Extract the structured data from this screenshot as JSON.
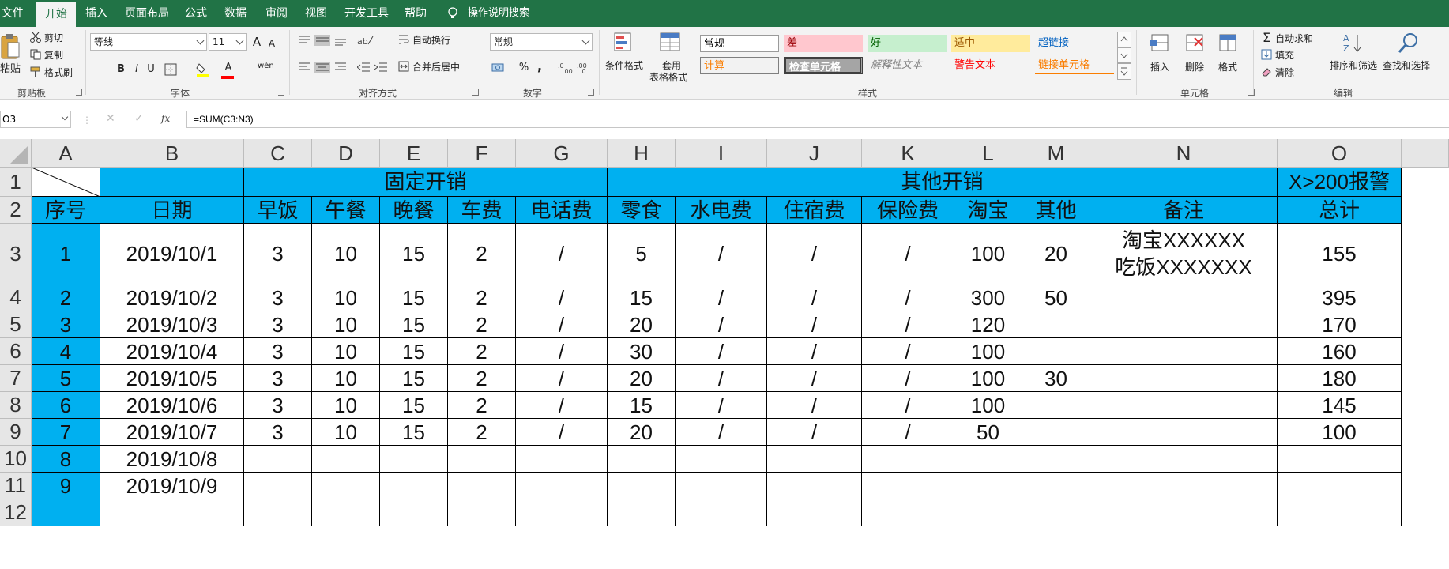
{
  "menu": {
    "tabs": [
      "文件",
      "开始",
      "插入",
      "页面布局",
      "公式",
      "数据",
      "审阅",
      "视图",
      "开发工具",
      "帮助"
    ],
    "active": "开始",
    "tell_me": "操作说明搜索"
  },
  "ribbon": {
    "clipboard": {
      "group": "剪贴板",
      "paste": "粘贴",
      "cut": "剪切",
      "copy": "复制",
      "format_painter": "格式刷"
    },
    "font": {
      "group": "字体",
      "name": "等线",
      "size": "11",
      "bold": "B",
      "italic": "I",
      "underline": "U",
      "grow": "A",
      "shrink": "A",
      "font_color": "A",
      "phonetic": "wén"
    },
    "alignment": {
      "group": "对齐方式",
      "wrap": "自动换行",
      "merge": "合并后居中"
    },
    "number": {
      "group": "数字",
      "format": "常规",
      "percent": "%",
      "comma": ","
    },
    "styles": {
      "group": "样式",
      "conditional": "条件格式",
      "table": [
        "套用",
        "表格格式"
      ],
      "cells": [
        {
          "label": "常规",
          "fg": "#000000",
          "bg": "#ffffff"
        },
        {
          "label": "差",
          "fg": "#9c0006",
          "bg": "#ffc7ce"
        },
        {
          "label": "好",
          "fg": "#006100",
          "bg": "#c6efce"
        },
        {
          "label": "适中",
          "fg": "#9c5700",
          "bg": "#ffeb9c"
        },
        {
          "label": "超链接",
          "fg": "#0563c1",
          "bg": "#f3f3f3"
        },
        {
          "label": "计算",
          "fg": "#fa7d00",
          "bg": "#f2f2f2"
        },
        {
          "label": "检查单元格",
          "fg": "#ffffff",
          "bg": "#a5a5a5"
        },
        {
          "label": "解释性文本",
          "fg": "#7f7f7f",
          "bg": "#f3f3f3"
        },
        {
          "label": "警告文本",
          "fg": "#ff0000",
          "bg": "#f3f3f3"
        },
        {
          "label": "链接单元格",
          "fg": "#fa7d00",
          "bg": "#f3f3f3"
        }
      ]
    },
    "cells_group": {
      "group": "单元格",
      "insert": "插入",
      "delete": "删除",
      "format": "格式"
    },
    "editing": {
      "group": "编辑",
      "autosum": "自动求和",
      "fill": "填充",
      "clear": "清除",
      "sort": "排序和筛选",
      "find": "查找和选择"
    }
  },
  "formula_bar": {
    "name_box": "O3",
    "fx": "fx",
    "formula": "=SUM(C3:N3)"
  },
  "columns": [
    "A",
    "B",
    "C",
    "D",
    "E",
    "F",
    "G",
    "H",
    "I",
    "J",
    "K",
    "L",
    "M",
    "N",
    "O"
  ],
  "rows": [
    "1",
    "2",
    "3",
    "4",
    "5",
    "6",
    "7",
    "8",
    "9",
    "10",
    "11",
    "12"
  ],
  "sheet": {
    "group_fixed": "固定开销",
    "group_other": "其他开销",
    "alert": "X>200报警",
    "headers": [
      "序号",
      "日期",
      "早饭",
      "午餐",
      "晚餐",
      "车费",
      "电话费",
      "零食",
      "水电费",
      "住宿费",
      "保险费",
      "淘宝",
      "其他",
      "备注",
      "总计"
    ],
    "data": [
      [
        "1",
        "2019/10/1",
        "3",
        "10",
        "15",
        "2",
        "/",
        "5",
        "/",
        "/",
        "/",
        "100",
        "20",
        "",
        "155"
      ],
      [
        "2",
        "2019/10/2",
        "3",
        "10",
        "15",
        "2",
        "/",
        "15",
        "/",
        "/",
        "/",
        "300",
        "50",
        "",
        "395"
      ],
      [
        "3",
        "2019/10/3",
        "3",
        "10",
        "15",
        "2",
        "/",
        "20",
        "/",
        "/",
        "/",
        "120",
        "",
        "",
        "170"
      ],
      [
        "4",
        "2019/10/4",
        "3",
        "10",
        "15",
        "2",
        "/",
        "30",
        "/",
        "/",
        "/",
        "100",
        "",
        "",
        "160"
      ],
      [
        "5",
        "2019/10/5",
        "3",
        "10",
        "15",
        "2",
        "/",
        "20",
        "/",
        "/",
        "/",
        "100",
        "30",
        "",
        "180"
      ],
      [
        "6",
        "2019/10/6",
        "3",
        "10",
        "15",
        "2",
        "/",
        "15",
        "/",
        "/",
        "/",
        "100",
        "",
        "",
        "145"
      ],
      [
        "7",
        "2019/10/7",
        "3",
        "10",
        "15",
        "2",
        "/",
        "20",
        "/",
        "/",
        "/",
        "50",
        "",
        "",
        "100"
      ],
      [
        "8",
        "2019/10/8",
        "",
        "",
        "",
        "",
        "",
        "",
        "",
        "",
        "",
        "",
        "",
        "",
        ""
      ],
      [
        "9",
        "2019/10/9",
        "",
        "",
        "",
        "",
        "",
        "",
        "",
        "",
        "",
        "",
        "",
        "",
        ""
      ],
      [
        "",
        "",
        "",
        "",
        "",
        "",
        "",
        "",
        "",
        "",
        "",
        "",
        "",
        "",
        ""
      ]
    ],
    "note_line1": "淘宝XXXXXX",
    "note_line2": "吃饭XXXXXXX"
  }
}
